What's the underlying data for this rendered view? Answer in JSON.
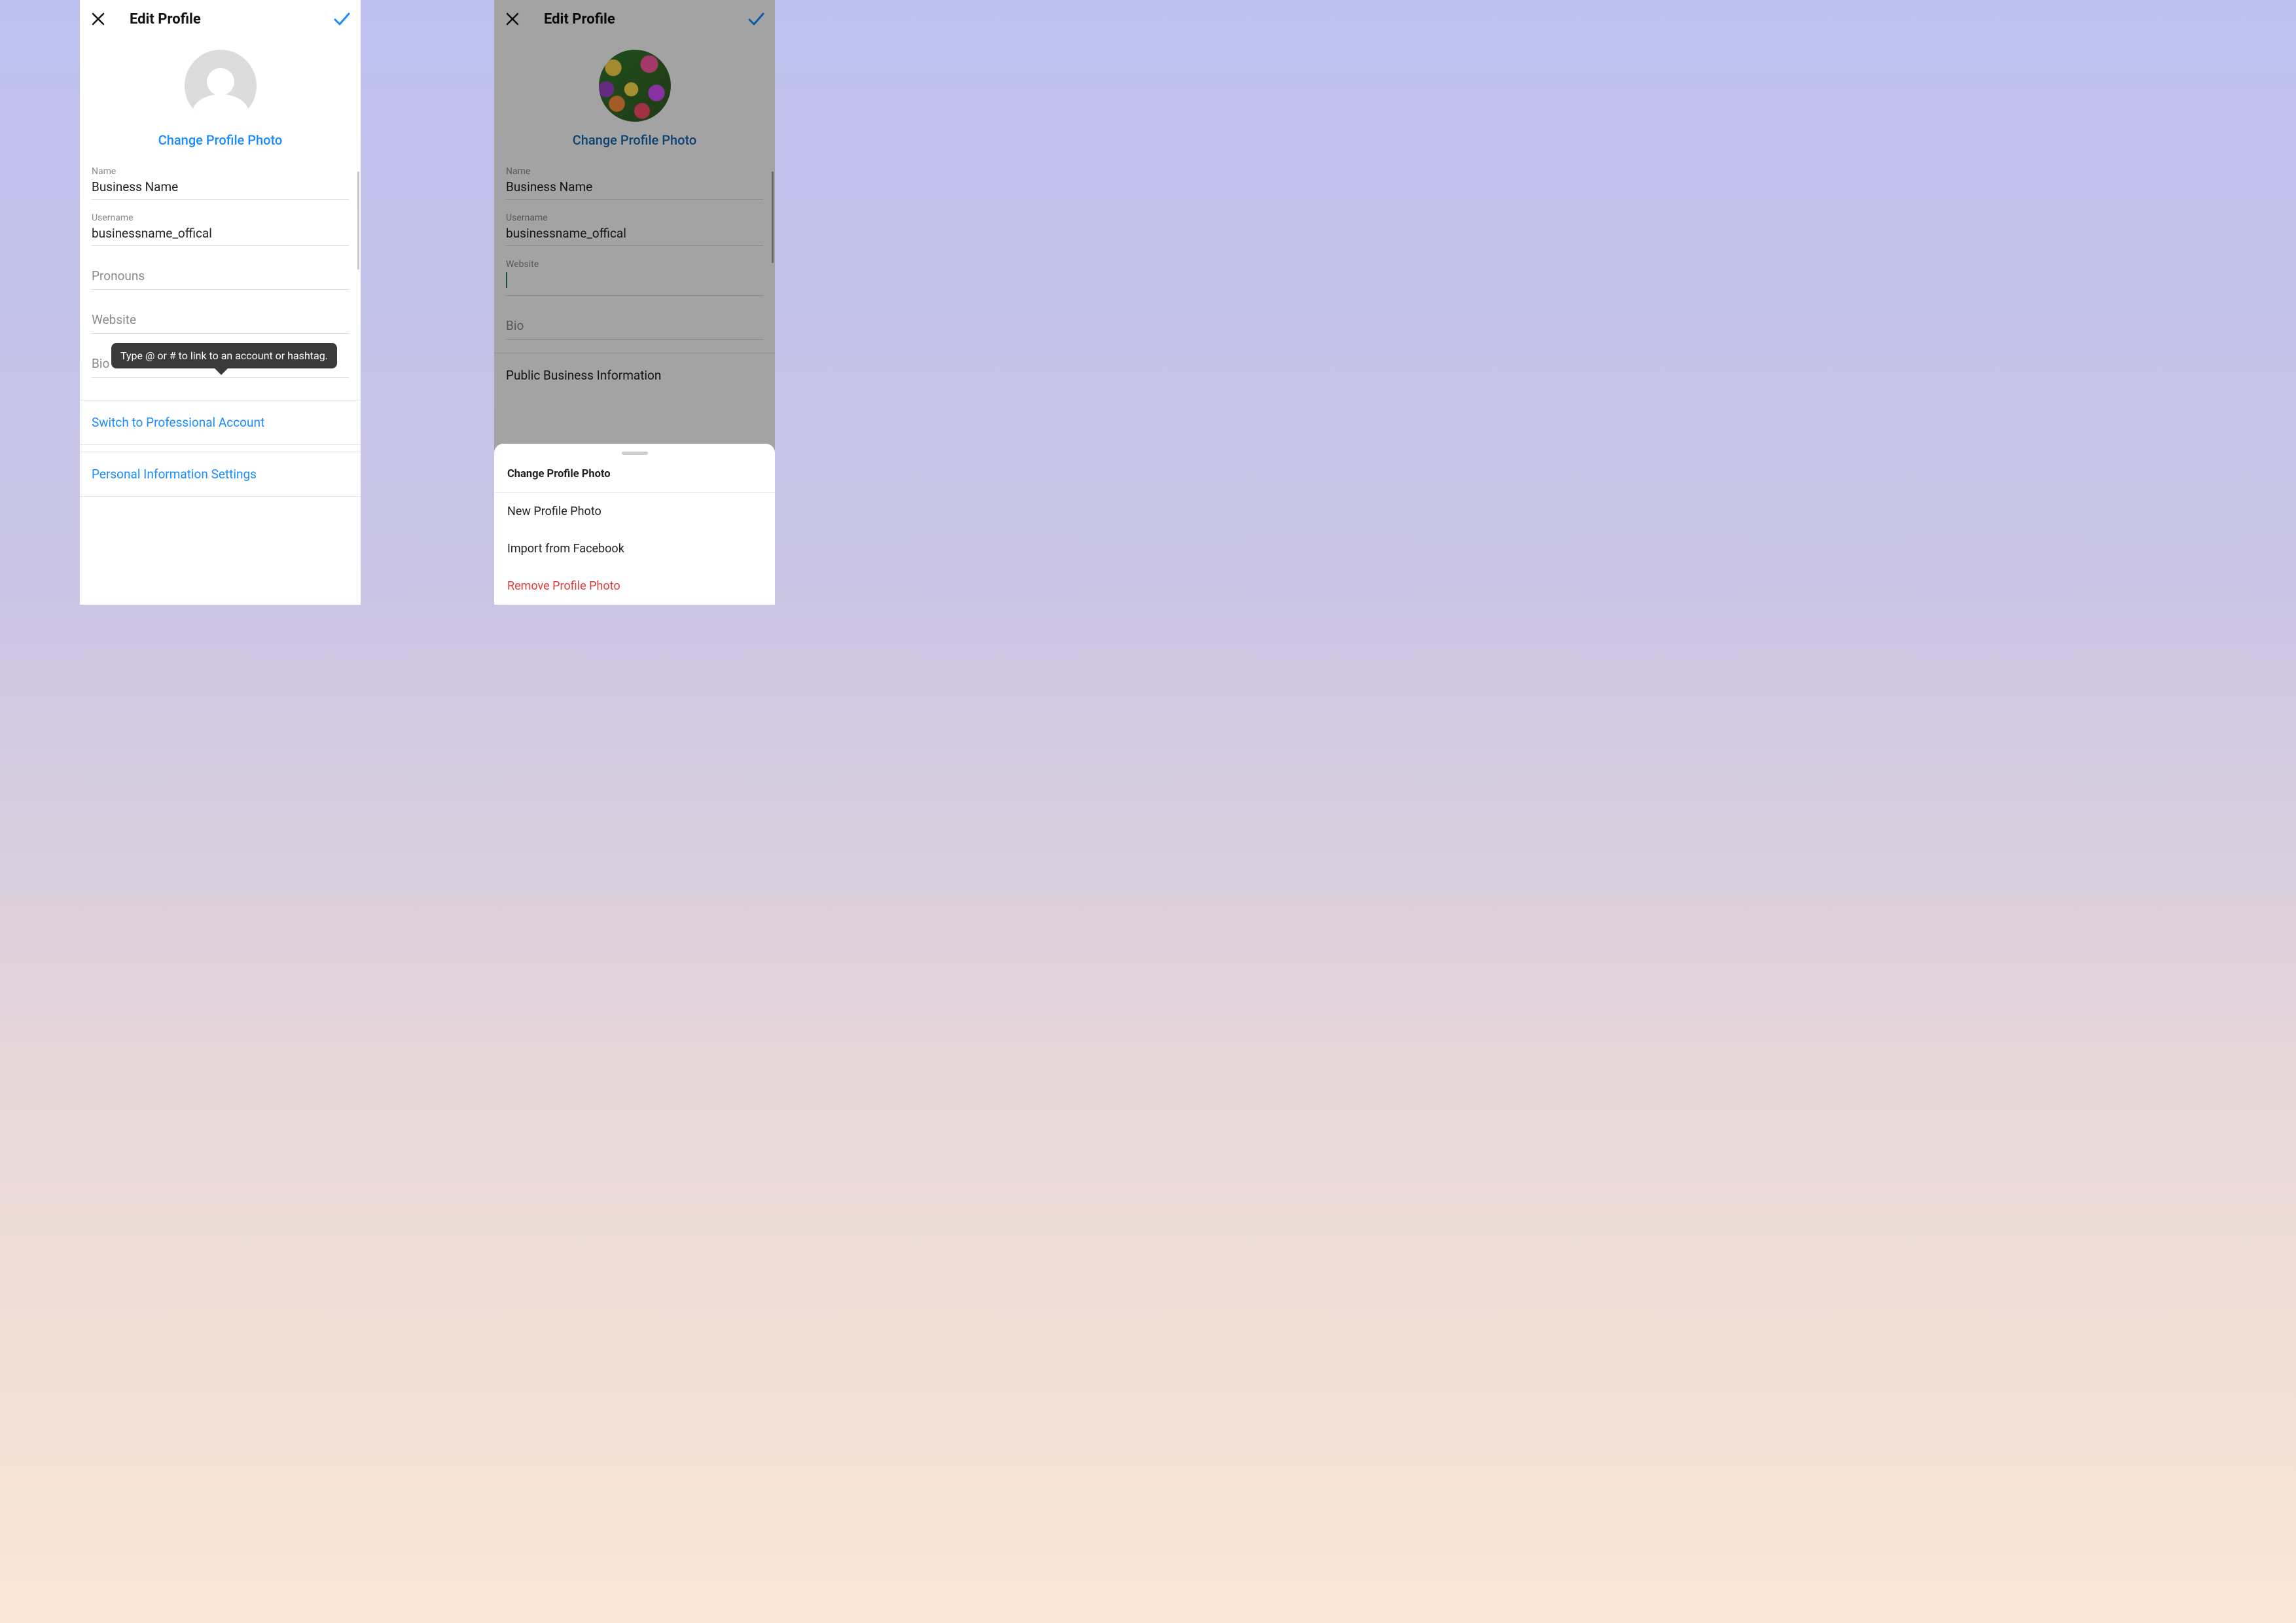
{
  "left": {
    "title": "Edit Profile",
    "changePhoto": "Change Profile Photo",
    "tooltip": "Type @ or # to link to an account or hashtag.",
    "fields": {
      "name": {
        "label": "Name",
        "value": "Business Name"
      },
      "username": {
        "label": "Username",
        "value": "businessname_offical"
      },
      "pronouns": {
        "placeholder": "Pronouns"
      },
      "website": {
        "placeholder": "Website"
      },
      "bio": {
        "placeholder": "Bio"
      }
    },
    "links": {
      "switchPro": "Switch to Professional Account",
      "personalInfo": "Personal Information Settings"
    }
  },
  "right": {
    "title": "Edit Profile",
    "changePhoto": "Change Profile Photo",
    "fields": {
      "name": {
        "label": "Name",
        "value": "Business Name"
      },
      "username": {
        "label": "Username",
        "value": "businessname_offical"
      },
      "website": {
        "label": "Website"
      },
      "bio": {
        "placeholder": "Bio"
      }
    },
    "section": "Public Business Information",
    "sheet": {
      "title": "Change Profile Photo",
      "newPhoto": "New Profile Photo",
      "importFb": "Import from Facebook",
      "remove": "Remove Profile Photo"
    }
  }
}
